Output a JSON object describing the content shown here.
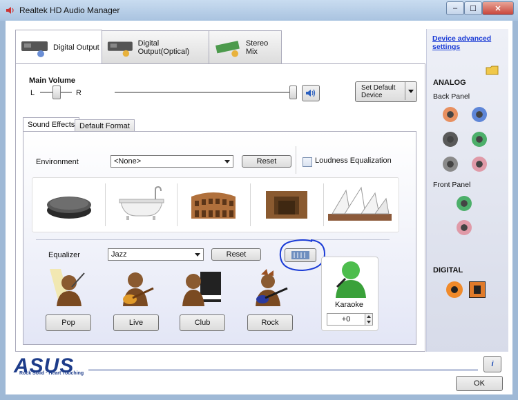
{
  "window": {
    "title": "Realtek HD Audio Manager",
    "minimize_label": "–",
    "maximize_label": "☐",
    "close_label": "✕"
  },
  "tabs": [
    {
      "label": "Digital Output"
    },
    {
      "label": "Digital Output(Optical)"
    },
    {
      "label": "Stereo Mix"
    }
  ],
  "volume": {
    "title": "Main Volume",
    "left_label": "L",
    "right_label": "R",
    "balance_level": 0.5,
    "volume_level": 1.0
  },
  "set_default": {
    "label_line1": "Set Default",
    "label_line2": "Device"
  },
  "subtabs": [
    {
      "label": "Sound Effects"
    },
    {
      "label": "Default Format"
    }
  ],
  "environment": {
    "label": "Environment",
    "selected": "<None>",
    "reset_label": "Reset",
    "loudness_label": "Loudness Equalization",
    "loudness_checked": false,
    "presets": [
      "stone",
      "bathtub",
      "colosseum",
      "room",
      "opera-house"
    ]
  },
  "equalizer": {
    "label": "Equalizer",
    "selected": "Jazz",
    "reset_label": "Reset",
    "presets": [
      "Pop",
      "Live",
      "Club",
      "Rock"
    ]
  },
  "karaoke": {
    "label": "Karaoke",
    "value": "+0"
  },
  "side": {
    "device_settings_line1": "Device advanced",
    "device_settings_line2": "settings",
    "analog_label": "ANALOG",
    "back_panel_label": "Back Panel",
    "front_panel_label": "Front Panel",
    "digital_label": "DIGITAL",
    "back_jacks": [
      "#e89060",
      "#5e86d8",
      "#5a5a5a",
      "#4caf6a",
      "#8a8a8a",
      "#e09aa8"
    ],
    "front_jacks": [
      "#4caf6a",
      "#e09aa8"
    ]
  },
  "footer": {
    "brand": "ASUS",
    "tagline": "Rock Solid · Heart Touching",
    "info_icon": "i",
    "ok_label": "OK"
  }
}
